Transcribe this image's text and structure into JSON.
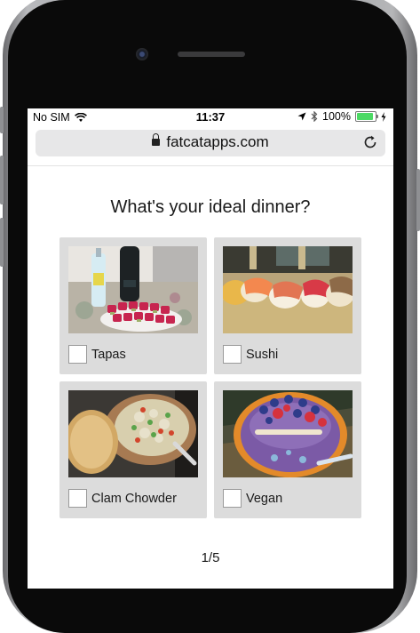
{
  "status_bar": {
    "carrier": "No SIM",
    "time": "11:37",
    "battery": "100%"
  },
  "browser": {
    "url": "fatcatapps.com"
  },
  "quiz": {
    "question": "What's your ideal dinner?",
    "options": [
      {
        "label": "Tapas"
      },
      {
        "label": "Sushi"
      },
      {
        "label": "Clam Chowder"
      },
      {
        "label": "Vegan"
      }
    ],
    "progress": "1/5"
  },
  "colors": {
    "card_bg": "#dcdcdc",
    "battery_green": "#4cd964",
    "url_bar": "#e7e7e8"
  }
}
